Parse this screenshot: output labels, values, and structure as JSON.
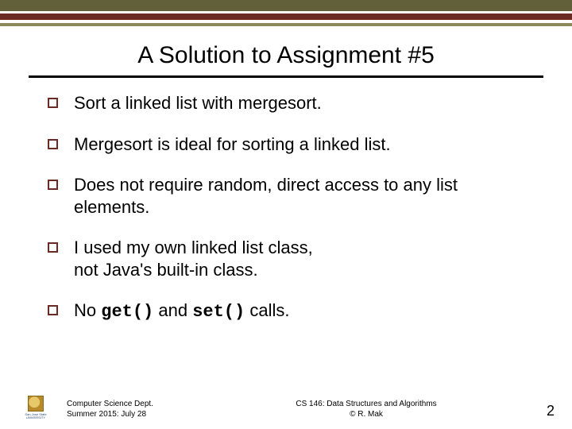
{
  "title": "A Solution to Assignment #5",
  "bullets": [
    {
      "text": "Sort a linked list with mergesort."
    },
    {
      "text": "Mergesort is ideal for sorting a linked list."
    },
    {
      "text": "Does not require random, direct access to any list elements."
    },
    {
      "text_a": "I used my own linked list class,",
      "text_b": "not Java's built-in class."
    },
    {
      "prefix": "No ",
      "code1": "get()",
      "mid": " and ",
      "code2": "set()",
      "suffix": " calls."
    }
  ],
  "footer": {
    "dept": "Computer Science Dept.",
    "term": "Summer 2015: July 28",
    "course": "CS 146: Data Structures and Algorithms",
    "author": "© R. Mak",
    "page": "2",
    "logo_name": "San José State",
    "logo_sub": "UNIVERSITY"
  }
}
